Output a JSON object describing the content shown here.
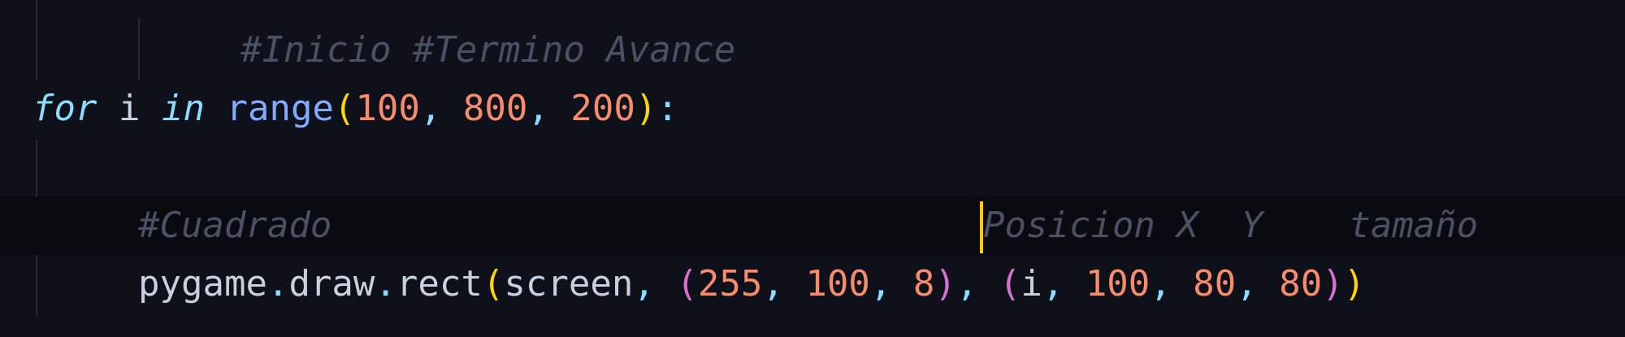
{
  "editor": {
    "colors": {
      "background": "#0f111a",
      "active_line": "#090b10",
      "cursor": "#ffcb00",
      "keyword": "#89ddff",
      "function": "#82aaff",
      "number": "#f78c6c",
      "bracket_level_1": "#ffd700",
      "bracket_level_2": "#da70d6",
      "comment": "#4b5164",
      "text": "#c8cfdf"
    },
    "lines": [
      {
        "comment": "#Inicio #Termino Avance"
      },
      {
        "kw_for": "for",
        "var_i": "i",
        "kw_in": "in",
        "fn_range": "range",
        "paren_open": "(",
        "n1": "100",
        "comma1": ",",
        "n2": "800",
        "comma2": ",",
        "n3": "200",
        "paren_close": ")",
        "colon": ":"
      },
      {},
      {
        "comment_left": "#Cuadrado",
        "comment_right": "Posicion X  Y    tamaño"
      },
      {
        "obj": "pygame",
        "dot1": ".",
        "attr1": "draw",
        "dot2": ".",
        "method": "rect",
        "p_open": "(",
        "arg_screen": "screen",
        "c1": ",",
        "t1_open": "(",
        "t1_a": "255",
        "c2": ",",
        "t1_b": "100",
        "c3": ",",
        "t1_c": "8",
        "t1_close": ")",
        "c4": ",",
        "t2_open": "(",
        "t2_a": "i",
        "c5": ",",
        "t2_b": "100",
        "c6": ",",
        "t2_c": "80",
        "c7": ",",
        "t2_d": "80",
        "t2_close": ")",
        "p_close": ")"
      }
    ]
  }
}
